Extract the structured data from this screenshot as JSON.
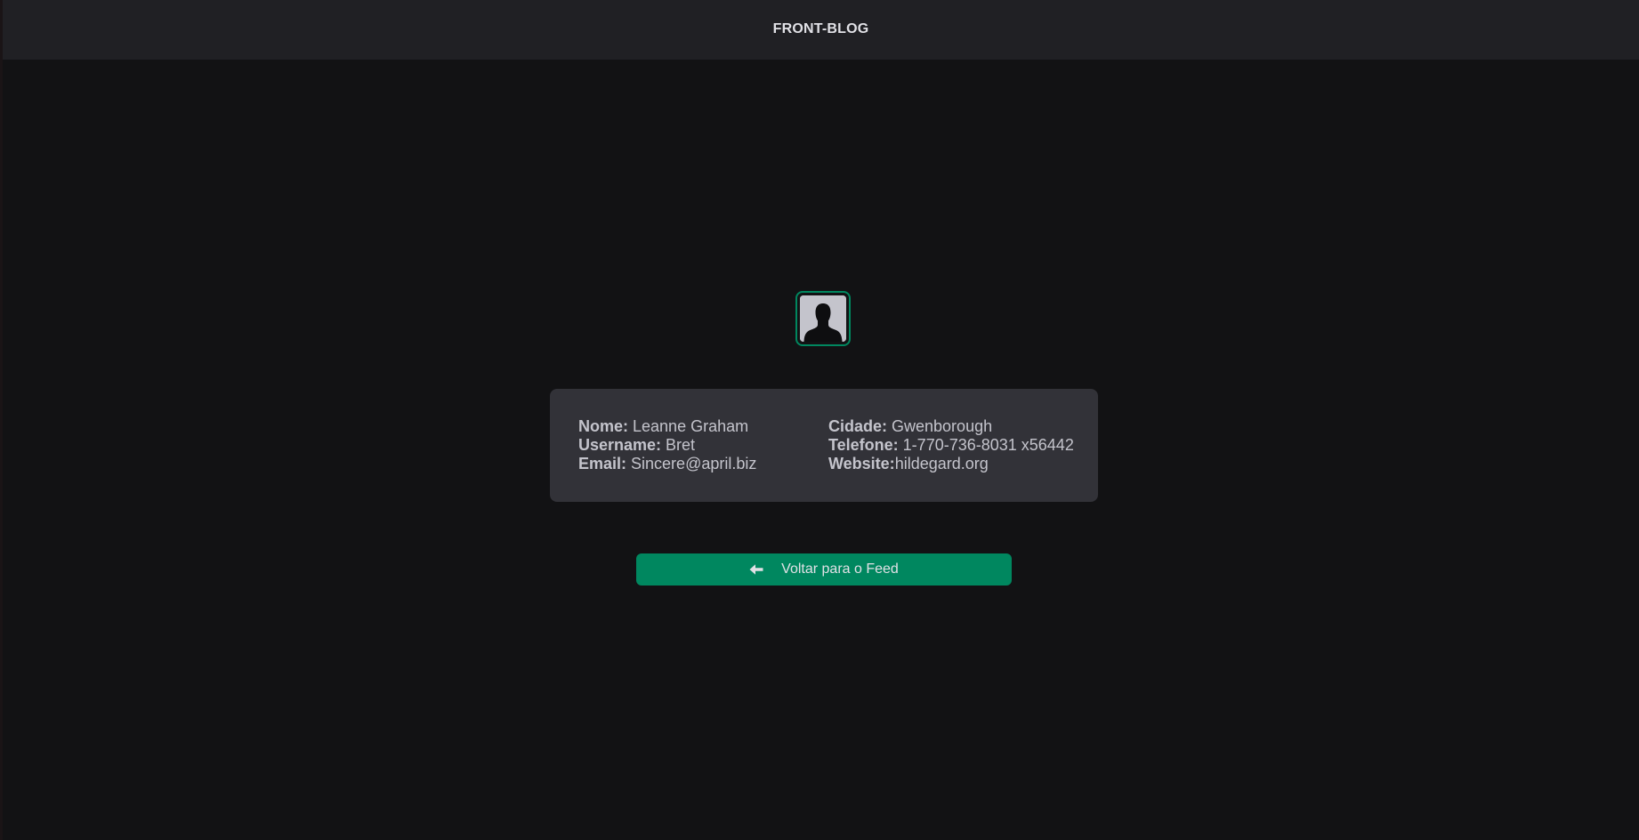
{
  "header": {
    "title": "FRONT-BLOG"
  },
  "profile": {
    "avatar_icon": "user-silhouette-icon",
    "accent_color": "#00875f",
    "fields_left": [
      {
        "label": "Nome:",
        "value": " Leanne Graham"
      },
      {
        "label": "Username:",
        "value": " Bret"
      },
      {
        "label": "Email:",
        "value": " Sincere@april.biz"
      }
    ],
    "fields_right": [
      {
        "label": "Cidade:",
        "value": " Gwenborough"
      },
      {
        "label": "Telefone:",
        "value": " 1-770-736-8031 x56442"
      },
      {
        "label": "Website:",
        "value": "hildegard.org"
      }
    ]
  },
  "back_button": {
    "icon": "arrow-left-icon",
    "label": "Voltar para o Feed"
  },
  "colors": {
    "background": "#121214",
    "header": "#202024",
    "card": "#323238",
    "text": "#c4c4cc",
    "primary": "#00875f"
  }
}
